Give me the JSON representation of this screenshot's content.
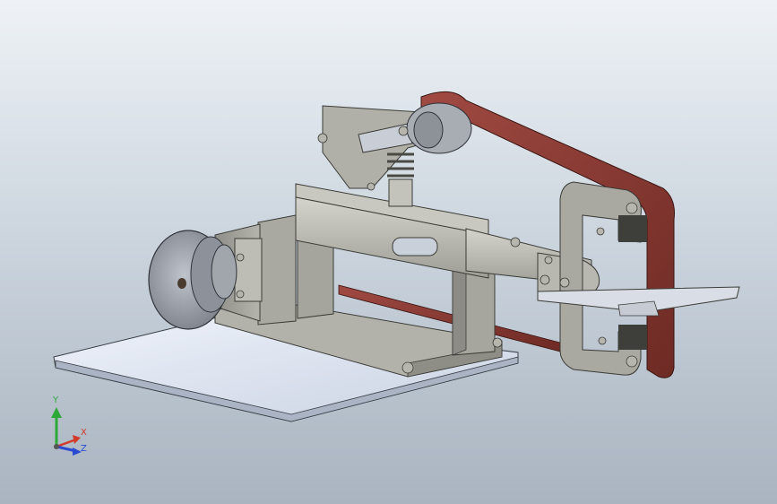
{
  "viewport": {
    "background_top": "#eef2f6",
    "background_bottom": "#a9b4c0"
  },
  "model": {
    "belt_color": "#8a3a32",
    "part_color": "#b9b8b0",
    "base_plate_color": "#dfe6f0"
  },
  "triad": {
    "x_label": "X",
    "y_label": "Y",
    "z_label": "Z",
    "x_color": "#d23a2a",
    "y_color": "#2fa83a",
    "z_color": "#2a4ad2"
  }
}
